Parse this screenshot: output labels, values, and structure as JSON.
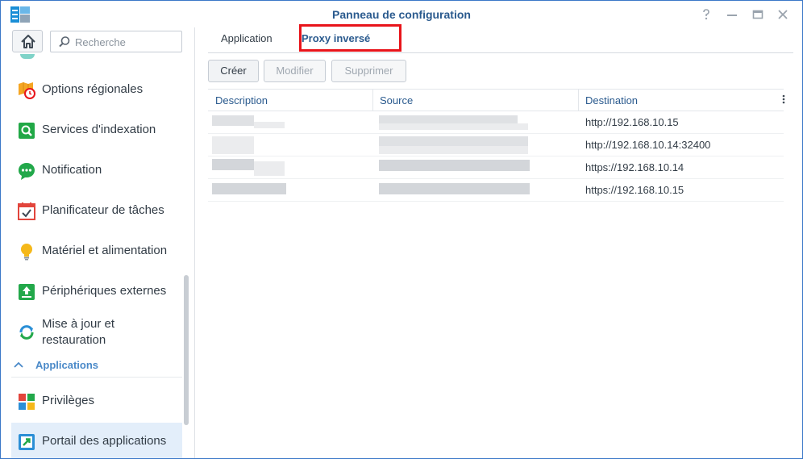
{
  "window": {
    "title": "Panneau de configuration",
    "controls": [
      "help-icon",
      "minimize-icon",
      "maximize-icon",
      "close-icon"
    ]
  },
  "sidebar": {
    "search_placeholder": "Recherche",
    "items": [
      {
        "label": "Options régionales",
        "icon": "regional-options-icon"
      },
      {
        "label": "Services d'indexation",
        "icon": "indexing-icon"
      },
      {
        "label": "Notification",
        "icon": "notification-icon"
      },
      {
        "label": "Planificateur de tâches",
        "icon": "task-scheduler-icon"
      },
      {
        "label": "Matériel et alimentation",
        "icon": "hardware-power-icon"
      },
      {
        "label": "Périphériques externes",
        "icon": "external-devices-icon"
      },
      {
        "label": "Mise à jour et restauration",
        "icon": "update-restore-icon"
      }
    ],
    "section": "Applications",
    "section_items": [
      {
        "label": "Privilèges",
        "icon": "privileges-icon"
      },
      {
        "label": "Portail des applications",
        "icon": "application-portal-icon",
        "active": true
      }
    ]
  },
  "tabs": [
    {
      "label": "Application",
      "active": false
    },
    {
      "label": "Proxy inversé",
      "active": true
    }
  ],
  "toolbar": {
    "create": "Créer",
    "edit": "Modifier",
    "delete": "Supprimer"
  },
  "table": {
    "columns": [
      "Description",
      "Source",
      "Destination"
    ],
    "rows": [
      {
        "description": "",
        "source": "",
        "destination": "http://192.168.10.15"
      },
      {
        "description": "",
        "source": "",
        "destination": "http://192.168.10.14:32400"
      },
      {
        "description": "",
        "source": "",
        "destination": "https://192.168.10.14"
      },
      {
        "description": "",
        "source": "",
        "destination": "https://192.168.10.15"
      }
    ]
  },
  "colors": {
    "accent": "#2a5a8e",
    "highlight_border": "#e8141a",
    "active_item_bg": "#e3eefa"
  }
}
